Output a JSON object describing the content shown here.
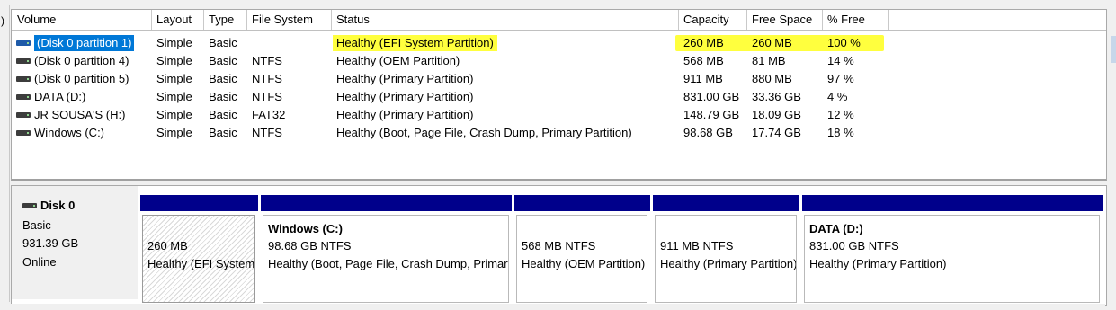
{
  "left_peek": ")",
  "columns": [
    "Volume",
    "Layout",
    "Type",
    "File System",
    "Status",
    "Capacity",
    "Free Space",
    "% Free"
  ],
  "volumes": [
    {
      "name": "(Disk 0 partition 1)",
      "layout": "Simple",
      "type": "Basic",
      "fs": "",
      "status": "Healthy (EFI System Partition)",
      "capacity": "260 MB",
      "free": "260 MB",
      "pct": "100 %",
      "selected": true,
      "highlighted": true
    },
    {
      "name": "(Disk 0 partition 4)",
      "layout": "Simple",
      "type": "Basic",
      "fs": "NTFS",
      "status": "Healthy (OEM Partition)",
      "capacity": "568 MB",
      "free": "81 MB",
      "pct": "14 %"
    },
    {
      "name": "(Disk 0 partition 5)",
      "layout": "Simple",
      "type": "Basic",
      "fs": "NTFS",
      "status": "Healthy (Primary Partition)",
      "capacity": "911 MB",
      "free": "880 MB",
      "pct": "97 %"
    },
    {
      "name": "DATA (D:)",
      "layout": "Simple",
      "type": "Basic",
      "fs": "NTFS",
      "status": "Healthy (Primary Partition)",
      "capacity": "831.00 GB",
      "free": "33.36 GB",
      "pct": "4 %"
    },
    {
      "name": "JR SOUSA'S (H:)",
      "layout": "Simple",
      "type": "Basic",
      "fs": "FAT32",
      "status": "Healthy (Primary Partition)",
      "capacity": "148.79 GB",
      "free": "18.09 GB",
      "pct": "12 %"
    },
    {
      "name": "Windows (C:)",
      "layout": "Simple",
      "type": "Basic",
      "fs": "NTFS",
      "status": "Healthy (Boot, Page File, Crash Dump, Primary Partition)",
      "capacity": "98.68 GB",
      "free": "17.74 GB",
      "pct": "18 %"
    }
  ],
  "disk": {
    "name": "Disk 0",
    "type": "Basic",
    "size": "931.39 GB",
    "state": "Online"
  },
  "partitions": [
    {
      "title": "",
      "size": "260 MB",
      "status": "Healthy (EFI System Partition)",
      "hatched": true
    },
    {
      "title": "Windows  (C:)",
      "size": "98.68 GB NTFS",
      "status": "Healthy (Boot, Page File, Crash Dump, Primary Partition)"
    },
    {
      "title": "",
      "size": "568 MB NTFS",
      "status": "Healthy (OEM Partition)"
    },
    {
      "title": "",
      "size": "911 MB NTFS",
      "status": "Healthy (Primary Partition)"
    },
    {
      "title": "DATA  (D:)",
      "size": "831.00 GB NTFS",
      "status": "Healthy (Primary Partition)"
    }
  ],
  "colors": {
    "highlight": "#ffff3e",
    "selection": "#0078d7",
    "partition_bar": "#00008b"
  },
  "icons": {
    "disk": "disk-drive-icon",
    "volume": "volume-icon"
  }
}
